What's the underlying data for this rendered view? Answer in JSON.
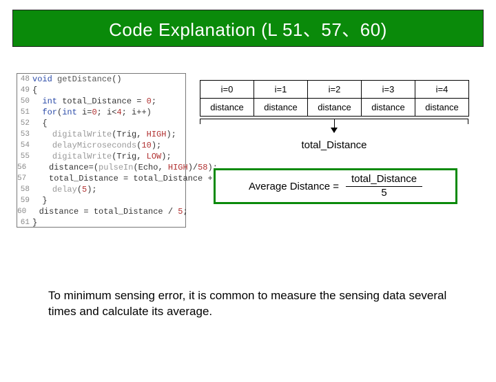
{
  "title": "Code Explanation (L 51、57、60)",
  "code": {
    "lines": [
      {
        "n": "48",
        "indent": 0,
        "html": "<span class='kw'>void</span> <span class='fn'>getDistance</span>()"
      },
      {
        "n": "49",
        "indent": 0,
        "html": "{"
      },
      {
        "n": "50",
        "indent": 1,
        "html": "<span class='kw'>int</span> total_Distance = <span class='lit'>0</span>;"
      },
      {
        "n": "51",
        "indent": 1,
        "html": "<span class='kw'>for</span>(<span class='kw'>int</span> i=<span class='lit'>0</span>; i&lt;<span class='lit'>4</span>; i++)"
      },
      {
        "n": "52",
        "indent": 1,
        "html": "{"
      },
      {
        "n": "53",
        "indent": 2,
        "html": "<span class='dim'>digitalWrite</span>(Trig, <span class='lit'>HIGH</span>);"
      },
      {
        "n": "54",
        "indent": 2,
        "html": "<span class='dim'>delayMicroseconds</span>(<span class='lit'>10</span>);"
      },
      {
        "n": "55",
        "indent": 2,
        "html": "<span class='dim'>digitalWrite</span>(Trig, <span class='lit'>LOW</span>);"
      },
      {
        "n": "56",
        "indent": 2,
        "html": "distance=(<span class='dim'>pulseIn</span>(Echo, <span class='lit'>HIGH</span>)/<span class='lit'>58</span>);"
      },
      {
        "n": "57",
        "indent": 2,
        "html": "total_Distance = total_Distance + distance;"
      },
      {
        "n": "58",
        "indent": 2,
        "html": "<span class='dim'>delay</span>(<span class='lit'>5</span>);"
      },
      {
        "n": "59",
        "indent": 1,
        "html": "}"
      },
      {
        "n": "60",
        "indent": 1,
        "html": "distance = total_Distance / <span class='lit'>5</span>;"
      },
      {
        "n": "61",
        "indent": 0,
        "html": "}"
      }
    ]
  },
  "table": {
    "headers": [
      "i=0",
      "i=1",
      "i=2",
      "i=3",
      "i=4"
    ],
    "row": [
      "distance",
      "distance",
      "distance",
      "distance",
      "distance"
    ]
  },
  "brace_label": "total_Distance",
  "formula": {
    "lhs": "Average Distance =",
    "num": "total_Distance",
    "den": "5"
  },
  "footer": "To minimum sensing error, it is common to measure the sensing data several times and calculate its average."
}
